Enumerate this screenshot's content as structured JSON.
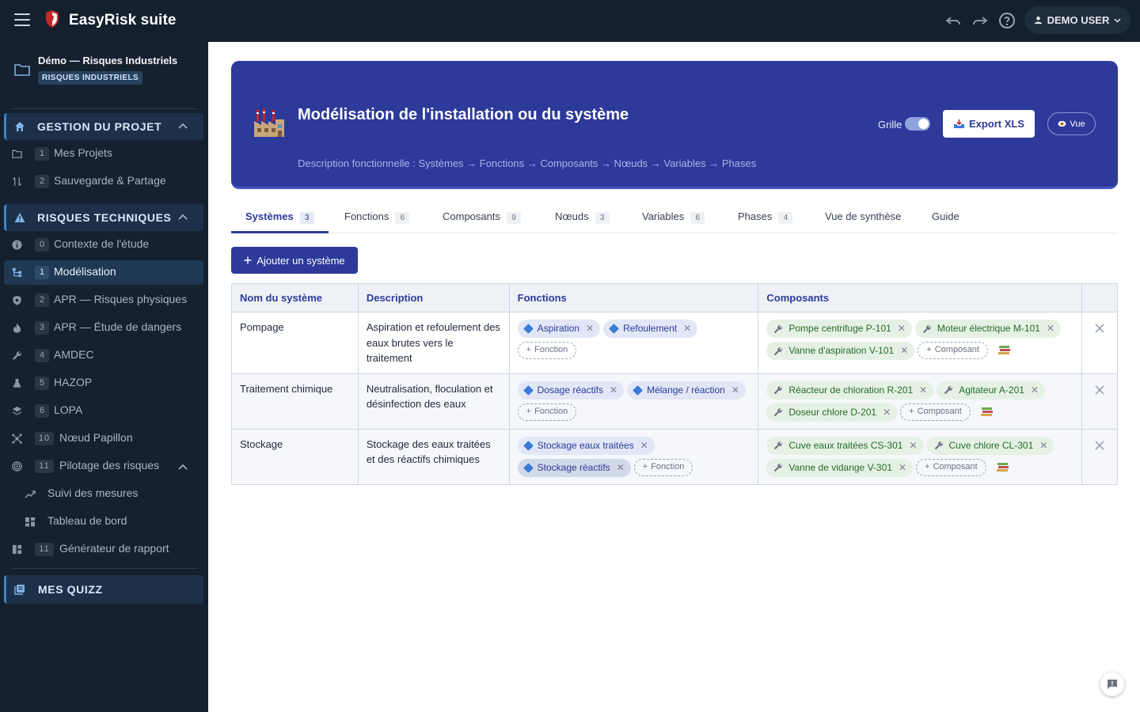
{
  "app": {
    "title": "EasyRisk suite"
  },
  "header": {
    "user_label": "DEMO USER"
  },
  "project": {
    "name": "Démo — Risques Industriels",
    "badge": "RISQUES INDUSTRIELS"
  },
  "sidebar": {
    "section_project": "GESTION DU PROJET",
    "project_items": [
      {
        "num": "1",
        "label": "Mes Projets"
      },
      {
        "num": "2",
        "label": "Sauvegarde & Partage"
      }
    ],
    "section_risks": "RISQUES TECHNIQUES ET INDUSTRIELS",
    "risk_items": [
      {
        "num": "0",
        "label": "Contexte de l'étude"
      },
      {
        "num": "1",
        "label": "Modélisation"
      },
      {
        "num": "2",
        "label": "APR — Risques physiques"
      },
      {
        "num": "3",
        "label": "APR — Étude de dangers"
      },
      {
        "num": "4",
        "label": "AMDEC"
      },
      {
        "num": "5",
        "label": "HAZOP"
      },
      {
        "num": "6",
        "label": "LOPA"
      },
      {
        "num": "10",
        "label": "Nœud Papillon"
      },
      {
        "num": "11",
        "label": "Pilotage des risques"
      }
    ],
    "sub_items": [
      {
        "label": "Suivi des mesures"
      },
      {
        "label": "Tableau de bord"
      }
    ],
    "report_item": {
      "num": "11",
      "label": "Générateur de rapport"
    },
    "section_quiz": "MES QUIZZ"
  },
  "hero": {
    "title": "Modélisation de l'installation ou du système",
    "subtitle": "Description fonctionnelle : Systèmes → Fonctions → Composants → Nœuds → Variables → Phases",
    "grid_label": "Grille",
    "grid_on": true,
    "export_label": "Export XLS",
    "view_label": "Vue"
  },
  "tabs": [
    {
      "label": "Systèmes",
      "count": "3"
    },
    {
      "label": "Fonctions",
      "count": "6"
    },
    {
      "label": "Composants",
      "count": "9"
    },
    {
      "label": "Nœuds",
      "count": "3"
    },
    {
      "label": "Variables",
      "count": "6"
    },
    {
      "label": "Phases",
      "count": "4"
    },
    {
      "label": "Vue de synthèse",
      "count": ""
    },
    {
      "label": "Guide",
      "count": ""
    }
  ],
  "add_system_label": "Ajouter un système",
  "table": {
    "headers": [
      "Nom du système",
      "Description",
      "Fonctions",
      "Composants",
      ""
    ],
    "add_function_label": "Fonction",
    "add_component_label": "Composant",
    "rows": [
      {
        "name": "Pompage",
        "description": "Aspiration et refoulement des eaux brutes vers le traitement",
        "functions": [
          "Aspiration",
          "Refoulement"
        ],
        "components": [
          "Pompe centrifuge P-101",
          "Moteur électrique M-101",
          "Vanne d'aspiration V-101"
        ]
      },
      {
        "name": "Traitement chimique",
        "description": "Neutralisation, floculation et désinfection des eaux",
        "functions": [
          "Dosage réactifs",
          "Mélange / réaction"
        ],
        "components": [
          "Réacteur de chloration R-201",
          "Agitateur A-201",
          "Doseur chlore D-201"
        ]
      },
      {
        "name": "Stockage",
        "description": "Stockage des eaux traitées et des réactifs chimiques",
        "functions": [
          "Stockage eaux traitées",
          "Stockage réactifs"
        ],
        "components": [
          "Cuve eaux traitées CS-301",
          "Cuve chlore CL-301",
          "Vanne de vidange V-301"
        ]
      }
    ]
  },
  "colors": {
    "accent": "#2d3a9a",
    "sidebar_bg": "#16212f",
    "topbar_bg": "#14202e",
    "chip_fn": "#e1e7f6",
    "chip_comp": "#e5f1e4"
  }
}
